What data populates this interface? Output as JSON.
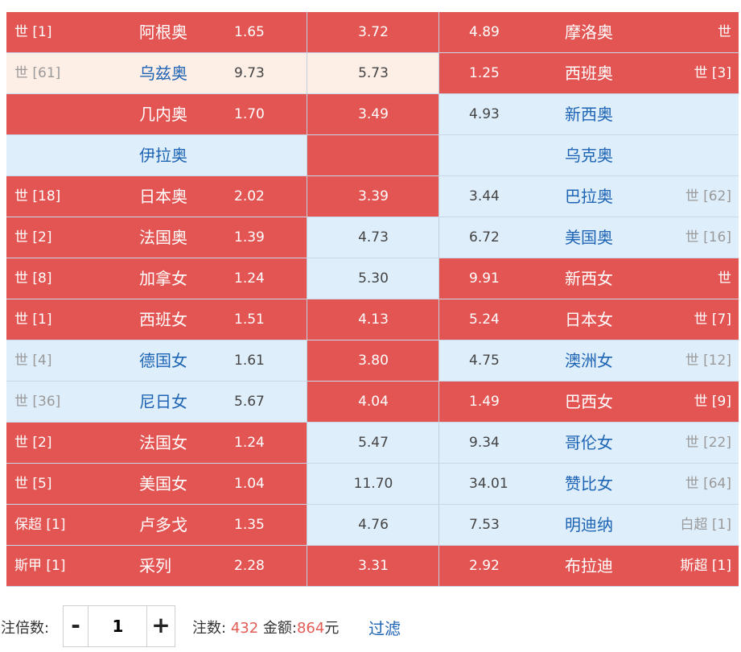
{
  "rows": [
    {
      "lt": "世 [1]",
      "ln": "阿根奥",
      "lo": "1.65",
      "d": "3.72",
      "ro": "4.89",
      "rn": "摩洛奥",
      "rt": "世",
      "c1": "red",
      "c2": "red",
      "c3": "red"
    },
    {
      "lt": "世 [61]",
      "ln": "乌兹奥",
      "lo": "9.73",
      "d": "5.73",
      "ro": "1.25",
      "rn": "西班奥",
      "rt": "世 [3]",
      "c1": "cream",
      "c2": "cream",
      "c3": "red"
    },
    {
      "lt": "",
      "ln": "几内奥",
      "lo": "1.70",
      "d": "3.49",
      "ro": "4.93",
      "rn": "新西奥",
      "rt": "",
      "c1": "red",
      "c2": "red",
      "c3": "blue"
    },
    {
      "lt": "",
      "ln": "伊拉奥",
      "lo": "",
      "d": "",
      "ro": "",
      "rn": "乌克奥",
      "rt": "",
      "c1": "blue",
      "c2": "red",
      "c3": "blue"
    },
    {
      "lt": "世 [18]",
      "ln": "日本奥",
      "lo": "2.02",
      "d": "3.39",
      "ro": "3.44",
      "rn": "巴拉奥",
      "rt": "世 [62]",
      "c1": "red",
      "c2": "red",
      "c3": "blue"
    },
    {
      "lt": "世 [2]",
      "ln": "法国奥",
      "lo": "1.39",
      "d": "4.73",
      "ro": "6.72",
      "rn": "美国奥",
      "rt": "世 [16]",
      "c1": "red",
      "c2": "blue",
      "c3": "blue"
    },
    {
      "lt": "世 [8]",
      "ln": "加拿女",
      "lo": "1.24",
      "d": "5.30",
      "ro": "9.91",
      "rn": "新西女",
      "rt": "世",
      "c1": "red",
      "c2": "blue",
      "c3": "red"
    },
    {
      "lt": "世 [1]",
      "ln": "西班女",
      "lo": "1.51",
      "d": "4.13",
      "ro": "5.24",
      "rn": "日本女",
      "rt": "世 [7]",
      "c1": "red",
      "c2": "red",
      "c3": "red"
    },
    {
      "lt": "世 [4]",
      "ln": "德国女",
      "lo": "1.61",
      "d": "3.80",
      "ro": "4.75",
      "rn": "澳洲女",
      "rt": "世 [12]",
      "c1": "blue",
      "c2": "red",
      "c3": "blue"
    },
    {
      "lt": "世 [36]",
      "ln": "尼日女",
      "lo": "5.67",
      "d": "4.04",
      "ro": "1.49",
      "rn": "巴西女",
      "rt": "世 [9]",
      "c1": "blue",
      "c2": "red",
      "c3": "red"
    },
    {
      "lt": "世 [2]",
      "ln": "法国女",
      "lo": "1.24",
      "d": "5.47",
      "ro": "9.34",
      "rn": "哥伦女",
      "rt": "世 [22]",
      "c1": "red",
      "c2": "blue",
      "c3": "blue"
    },
    {
      "lt": "世 [5]",
      "ln": "美国女",
      "lo": "1.04",
      "d": "11.70",
      "ro": "34.01",
      "rn": "赞比女",
      "rt": "世 [64]",
      "c1": "red",
      "c2": "blue",
      "c3": "blue"
    },
    {
      "lt": "保超 [1]",
      "ln": "卢多戈",
      "lo": "1.35",
      "d": "4.76",
      "ro": "7.53",
      "rn": "明迪纳",
      "rt": "白超 [1]",
      "c1": "red",
      "c2": "blue",
      "c3": "blue"
    },
    {
      "lt": "斯甲 [1]",
      "ln": "采列",
      "lo": "2.28",
      "d": "3.31",
      "ro": "2.92",
      "rn": "布拉迪",
      "rt": "斯超 [1]",
      "c1": "red",
      "c2": "red",
      "c3": "red"
    }
  ],
  "footer": {
    "multiplier_label": "投注倍数:",
    "minus": "-",
    "plus": "+",
    "multiplier_value": "1",
    "count_label": "注数:",
    "count_value": "432",
    "amount_label": "金额:",
    "amount_value": "864",
    "amount_unit": "元",
    "filter": "过滤"
  },
  "colors": {
    "selected_bg": "#e25552",
    "unselected_bg": "#dfeefb",
    "hover_bg": "#fdeee6",
    "team_link": "#1d64b4",
    "highlight_number": "#e35b55"
  }
}
